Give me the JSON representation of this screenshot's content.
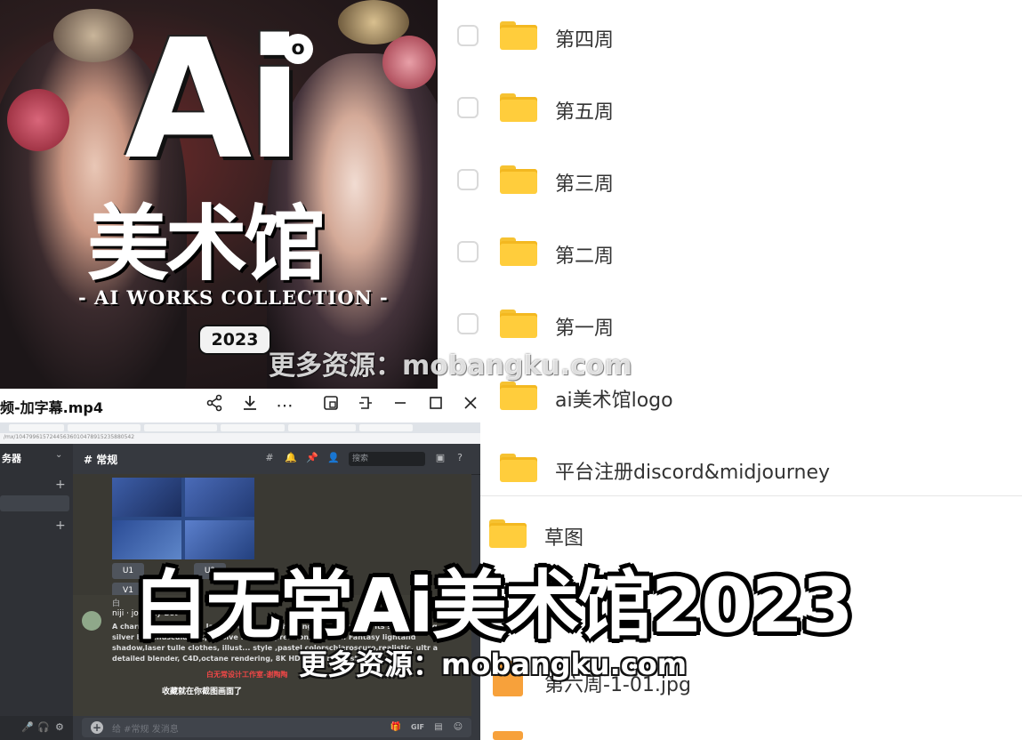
{
  "poster": {
    "logo_text": "Ai",
    "logo_small": "o",
    "title_cn": "美术馆",
    "subtitle": "- AI WORKS COLLECTION -",
    "year": "2023"
  },
  "file_list": {
    "rows": [
      {
        "name": "第四周",
        "type": "folder"
      },
      {
        "name": "第五周",
        "type": "folder"
      },
      {
        "name": "第三周",
        "type": "folder"
      },
      {
        "name": "第二周",
        "type": "folder"
      },
      {
        "name": "第一周",
        "type": "folder"
      },
      {
        "name": "ai美术馆logo",
        "type": "folder"
      },
      {
        "name": "平台注册discord&midjourney",
        "type": "folder"
      },
      {
        "name": "草图",
        "type": "folder"
      },
      {
        "name": "第六周-1-01.jpg",
        "type": "image"
      }
    ]
  },
  "player": {
    "title": "频-加字幕.mp4",
    "controls": [
      "share-icon",
      "download-icon",
      "more-icon",
      "pip-icon",
      "pin-icon",
      "minimize-icon",
      "maximize-icon",
      "close-icon"
    ],
    "browser_url": "/mx/10479961572445636010478915235880542"
  },
  "discord": {
    "server_name": "务器",
    "channel_name": "# 常规",
    "search_placeholder": "搜索",
    "upscale_buttons": [
      "U1",
      "U3",
      "V1"
    ],
    "bot_name_label": "白",
    "username": "niji · journey Bot",
    "prompt_text": "A charming young girl, Japanese samurai, holding a long knife in its sheath, long silver hair,muscular, expressive facial expressions and b... Fantasy lightand shadow,laser tulle clothes, illust... style ,pastel colorschiaroscuro,realistic, ultr a detailed blender, C4D,octane rendering, 8K HD (Waiting to start)",
    "studio_credit": "白无常设计工作室-谢陶陶",
    "subtitle_line": "收藏就在你截图画面了",
    "input_placeholder": "给 #常规 发消息"
  },
  "overlay": {
    "watermark_top": "更多资源：mobangku.com",
    "watermark_bottom": "更多资源：mobangku.com",
    "big_title": "白无常Ai美术馆2023"
  },
  "colors": {
    "folder_yellow": "#ffcd3c",
    "discord_bg": "#36393f",
    "image_file_orange": "#f7a13b"
  }
}
